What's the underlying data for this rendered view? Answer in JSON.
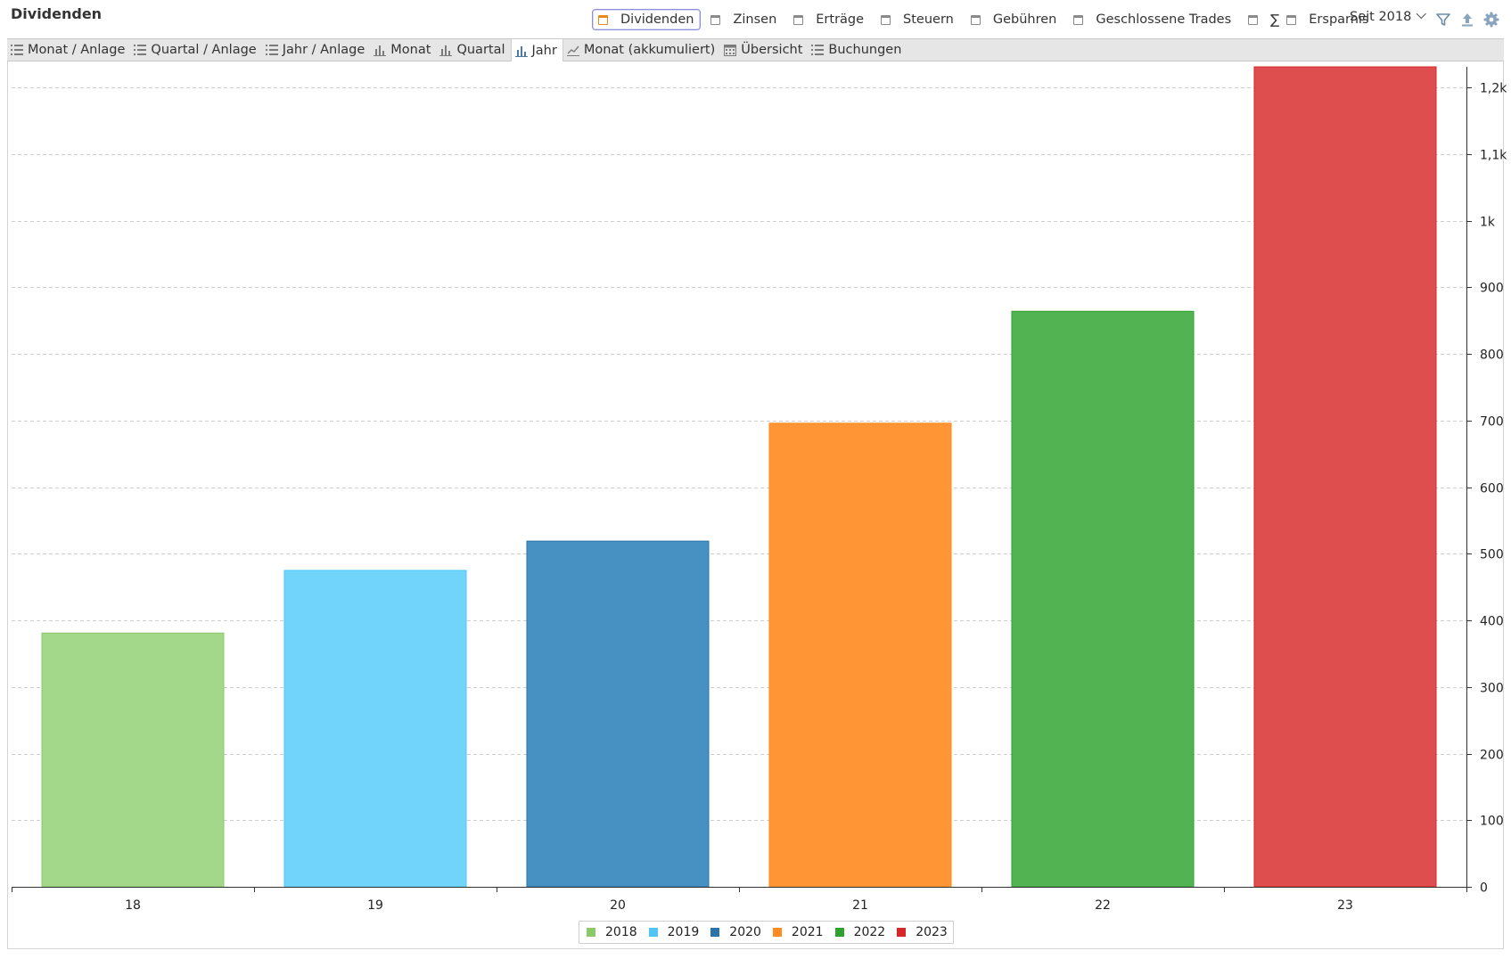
{
  "header": {
    "title": "Dividenden",
    "filters": [
      {
        "label": "Dividenden",
        "checked": true
      },
      {
        "label": "Zinsen",
        "checked": false
      },
      {
        "label": "Erträge",
        "checked": false
      },
      {
        "label": "Steuern",
        "checked": false
      },
      {
        "label": "Gebühren",
        "checked": false
      },
      {
        "label": "Geschlossene Trades",
        "checked": false
      },
      {
        "label": "Ersparnis",
        "checked": false,
        "sigma": "∑"
      }
    ],
    "period": "Seit 2018",
    "tools": [
      "filter-icon",
      "export-icon",
      "settings-icon"
    ]
  },
  "tabs": [
    {
      "label": "Monat / Anlage",
      "icon": "list-icon",
      "active": false
    },
    {
      "label": "Quartal / Anlage",
      "icon": "list-icon",
      "active": false
    },
    {
      "label": "Jahr / Anlage",
      "icon": "list-icon",
      "active": false
    },
    {
      "label": "Monat",
      "icon": "bar-chart-icon",
      "active": false
    },
    {
      "label": "Quartal",
      "icon": "bar-chart-icon",
      "active": false
    },
    {
      "label": "Jahr",
      "icon": "bar-chart-icon",
      "active": true
    },
    {
      "label": "Monat (akkumuliert)",
      "icon": "line-chart-icon",
      "active": false
    },
    {
      "label": "Übersicht",
      "icon": "calendar-icon",
      "active": false
    },
    {
      "label": "Buchungen",
      "icon": "list-icon",
      "active": false
    }
  ],
  "chart_data": {
    "type": "bar",
    "categories": [
      "18",
      "19",
      "20",
      "21",
      "22",
      "23"
    ],
    "values": [
      381,
      475,
      519,
      696,
      864,
      1231
    ],
    "colors": [
      "#a3d78a",
      "#71d5fb",
      "#4791c2",
      "#ff9535",
      "#52b353",
      "#de4e4e"
    ],
    "ylim": [
      0,
      1231
    ],
    "yticks": [
      0,
      100,
      200,
      300,
      400,
      500,
      600,
      700,
      800,
      900,
      1000,
      1100,
      1200
    ],
    "ytick_labels": [
      "0",
      "100",
      "200",
      "300",
      "400",
      "500",
      "600",
      "700",
      "800",
      "900",
      "1k",
      "1,1k",
      "1,2k"
    ],
    "yaxis_side": "right",
    "grid": true,
    "legend": {
      "placement": "bottom-center",
      "entries": [
        {
          "label": "2018",
          "color": "#8cc96a"
        },
        {
          "label": "2019",
          "color": "#4fc6f5"
        },
        {
          "label": "2020",
          "color": "#2a74a8"
        },
        {
          "label": "2021",
          "color": "#ff8a1f"
        },
        {
          "label": "2022",
          "color": "#2ea12e"
        },
        {
          "label": "2023",
          "color": "#d62728"
        }
      ]
    }
  }
}
